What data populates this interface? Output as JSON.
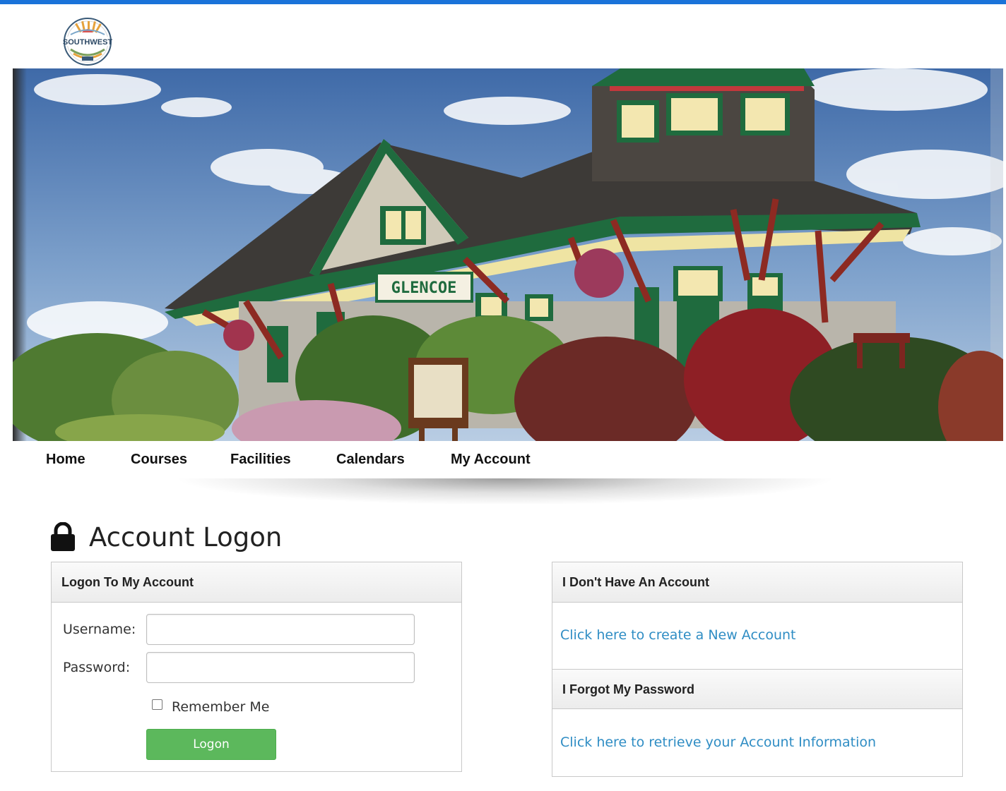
{
  "brand": {
    "logo_text": "SOUTHWEST",
    "accent": "#1a73d9"
  },
  "banner": {
    "sign_text": "GLENCOE"
  },
  "nav": {
    "items": [
      {
        "label": "Home"
      },
      {
        "label": "Courses"
      },
      {
        "label": "Facilities"
      },
      {
        "label": "Calendars"
      },
      {
        "label": "My Account"
      }
    ]
  },
  "page": {
    "title": "Account Logon",
    "icon": "lock-icon"
  },
  "logon_panel": {
    "header": "Logon To My Account",
    "username_label": "Username:",
    "username_value": "",
    "password_label": "Password:",
    "password_value": "",
    "remember_label": "Remember Me",
    "remember_checked": false,
    "logon_button": "Logon",
    "button_color": "#5cb85c"
  },
  "account_panel": {
    "no_account_header": "I Don't Have An Account",
    "create_link": "Click here to create a New Account",
    "forgot_header": "I Forgot My Password",
    "retrieve_link": "Click here to retrieve your Account Information",
    "link_color": "#2f8dc4"
  }
}
